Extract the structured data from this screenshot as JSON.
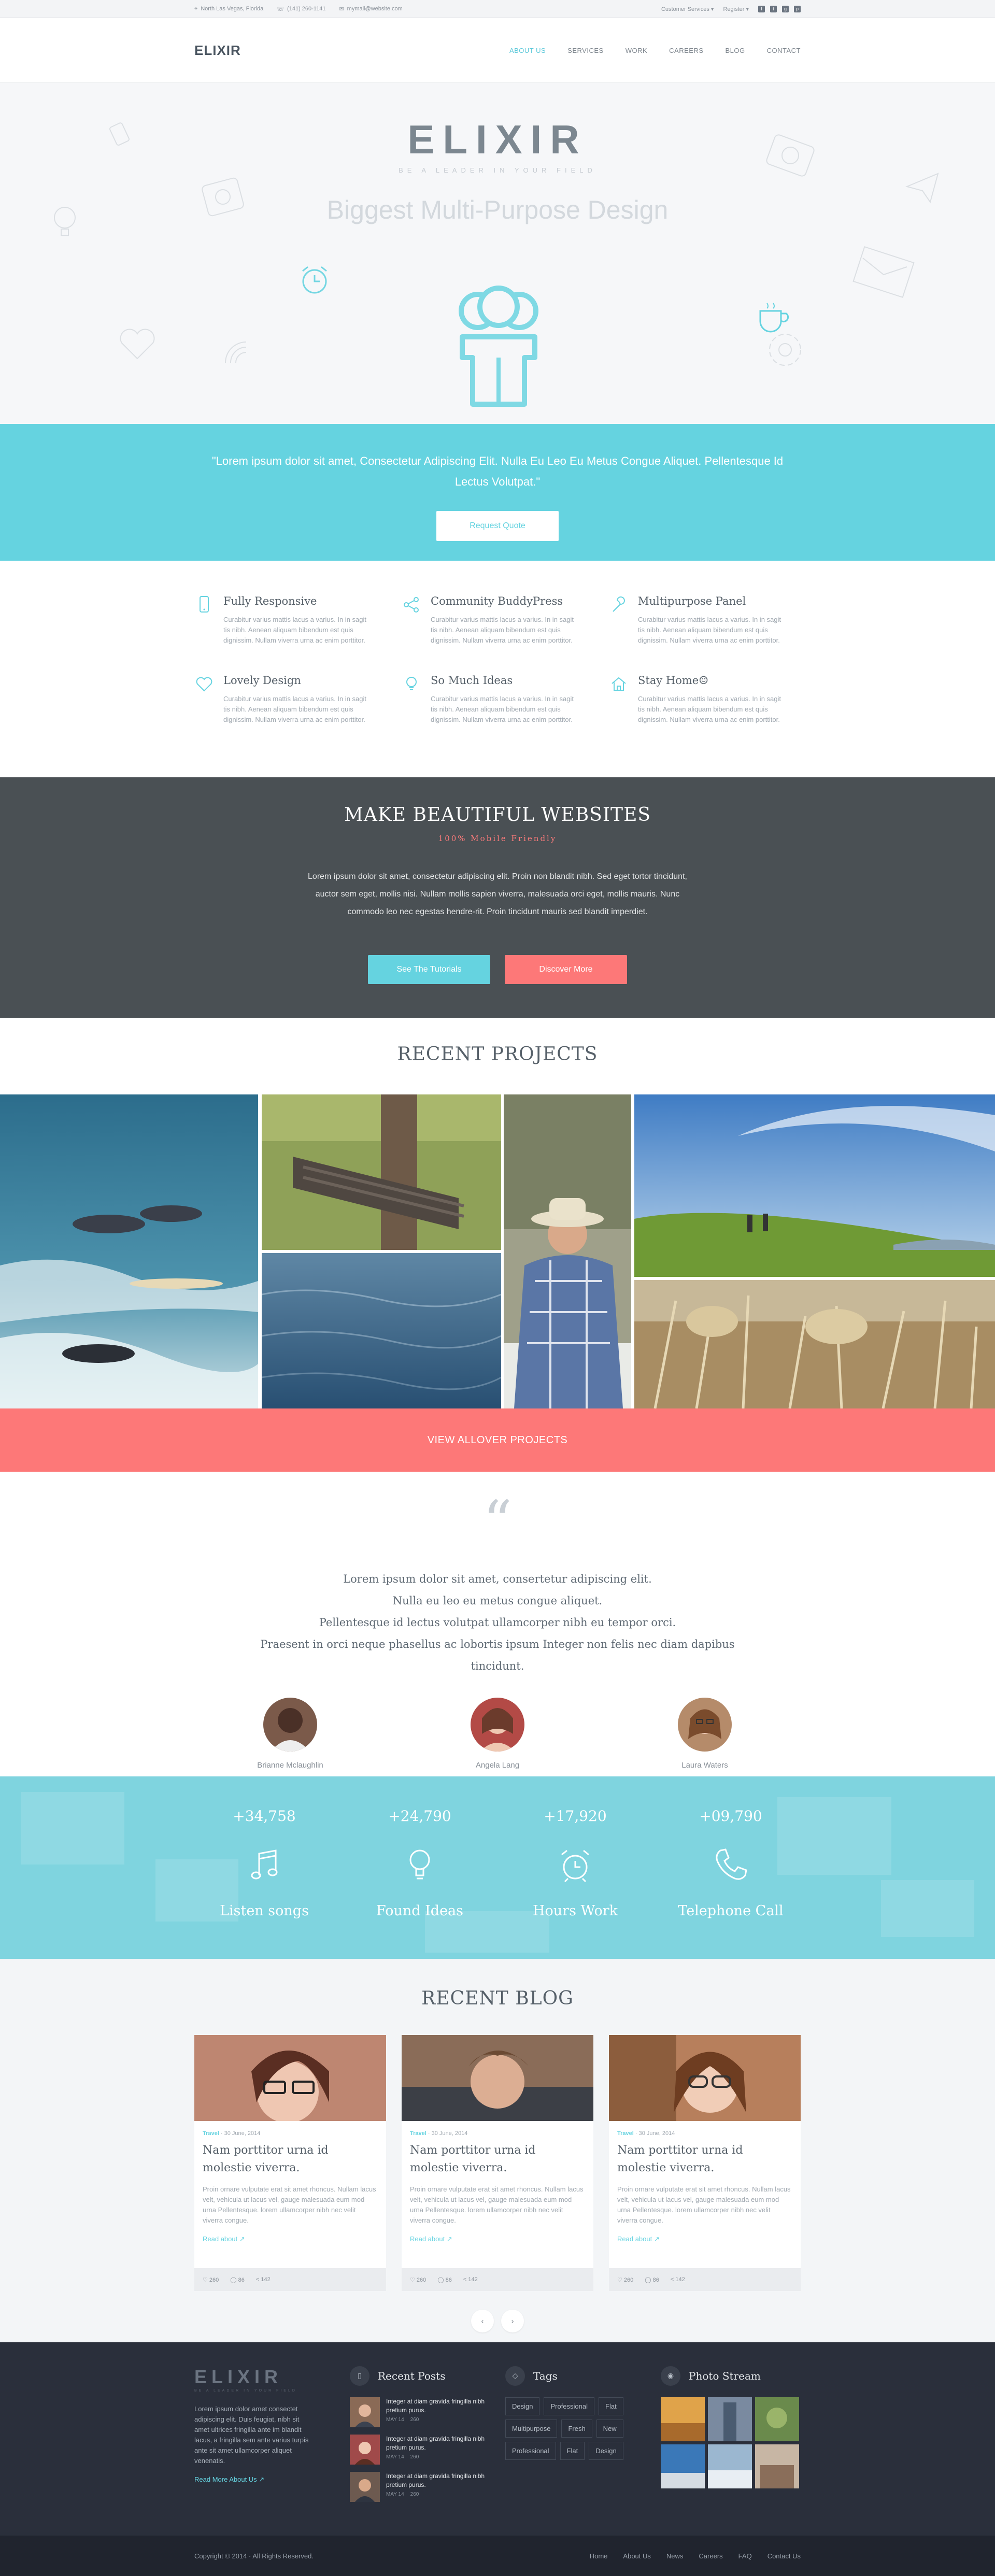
{
  "colors": {
    "accent": "#65d3e0",
    "coral": "#fd7878",
    "dark": "#4a5054",
    "footer": "#2a2f3b"
  },
  "topbar": {
    "address": "North Las Vegas, Florida",
    "phone": "(141) 260-1141",
    "email": "mymail@website.com",
    "customer_services": "Customer Services ▾",
    "register": "Register ▾",
    "social": [
      "f",
      "t",
      "g",
      "p"
    ]
  },
  "header": {
    "logo": "ELIXIR",
    "nav": [
      "ABOUT US",
      "SERVICES",
      "WORK",
      "CAREERS",
      "BLOG",
      "CONTACT"
    ]
  },
  "hero": {
    "brand": "ELIXIR",
    "tagline": "BE A LEADER IN YOUR FIELD",
    "headline": "Biggest Multi-Purpose Design"
  },
  "strip": {
    "quote": "\"Lorem ipsum dolor sit amet, Consectetur Adipiscing Elit. Nulla Eu Leo Eu Metus Congue Aliquet. Pellentesque Id Lectus Volutpat.\"",
    "button": "Request Quote"
  },
  "features": [
    {
      "icon": "phone-icon",
      "title": "Fully Responsive",
      "text": "Curabitur varius mattis lacus a varius. In in sagit tis nibh. Aenean aliquam bibendum est quis dignissim. Nullam viverra urna ac enim porttitor."
    },
    {
      "icon": "share-icon",
      "title": "Community BuddyPress",
      "text": "Curabitur varius mattis lacus a varius. In in sagit tis nibh. Aenean aliquam bibendum est quis dignissim. Nullam viverra urna ac enim porttitor."
    },
    {
      "icon": "wrench-icon",
      "title": "Multipurpose Panel",
      "text": "Curabitur varius mattis lacus a varius. In in sagit tis nibh. Aenean aliquam bibendum est quis dignissim. Nullam viverra urna ac enim porttitor."
    },
    {
      "icon": "heart-icon",
      "title": "Lovely Design",
      "text": "Curabitur varius mattis lacus a varius. In in sagit tis nibh. Aenean aliquam bibendum est quis dignissim. Nullam viverra urna ac enim porttitor."
    },
    {
      "icon": "bulb-icon",
      "title": "So Much Ideas",
      "text": "Curabitur varius mattis lacus a varius. In in sagit tis nibh. Aenean aliquam bibendum est quis dignissim. Nullam viverra urna ac enim porttitor."
    },
    {
      "icon": "home-icon",
      "title": "Stay Home☺",
      "text": "Curabitur varius mattis lacus a varius. In in sagit tis nibh. Aenean aliquam bibendum est quis dignissim. Nullam viverra urna ac enim porttitor."
    }
  ],
  "dark": {
    "title": "MAKE BEAUTIFUL WEBSITES",
    "subtitle": "100% Mobile Friendly",
    "text": "Lorem ipsum dolor sit amet, consectetur adipiscing elit. Proin non blandit nibh. Sed eget tortor tincidunt, auctor sem eget, mollis nisi. Nullam mollis sapien viverra, malesuada orci eget, mollis mauris. Nunc commodo leo nec egestas hendre-rit. Proin tincidunt mauris sed blandit imperdiet.",
    "btn_tutorials": "See The Tutorials",
    "btn_discover": "Discover More"
  },
  "projects": {
    "title": "RECENT PROJECTS",
    "view_all": "VIEW ALLOVER PROJECTS"
  },
  "testimonials": {
    "quote_mark": "“",
    "lines": [
      "Lorem ipsum dolor sit amet, consertetur adipiscing elit.",
      "Nulla eu leo eu metus congue aliquet.",
      "Pellentesque id lectus volutpat ullamcorper nibh eu tempor orci.",
      "Praesent in orci neque phasellus ac lobortis ipsum Integer non felis nec diam dapibus",
      "tincidunt."
    ],
    "people": [
      {
        "name": "Brianne Mclaughlin"
      },
      {
        "name": "Angela Lang"
      },
      {
        "name": "Laura Waters"
      }
    ]
  },
  "stats": [
    {
      "num": "+34,758",
      "label": "Listen songs",
      "icon": "music-note-icon"
    },
    {
      "num": "+24,790",
      "label": "Found Ideas",
      "icon": "bulb-icon"
    },
    {
      "num": "+17,920",
      "label": "Hours Work",
      "icon": "alarm-clock-icon"
    },
    {
      "num": "+09,790",
      "label": "Telephone Call",
      "icon": "telephone-icon"
    }
  ],
  "blog": {
    "title": "RECENT BLOG",
    "posts": [
      {
        "cat": "Travel",
        "date": " · 30 June, 2014",
        "title": "Nam porttitor urna id molestie viverra.",
        "text": "Proin ornare vulputate erat sit amet rhoncus. Nullam lacus velt, vehicula ut lacus vel, gauge malesuada eum mod urna Pellentesque. lorem ullamcorper nibh nec velit viverra congue.",
        "more": "Read about ↗",
        "likes": "260",
        "comments": "86",
        "shares": "142"
      },
      {
        "cat": "Travel",
        "date": " · 30 June, 2014",
        "title": "Nam porttitor urna id molestie viverra.",
        "text": "Proin ornare vulputate erat sit amet rhoncus. Nullam lacus velt, vehicula ut lacus vel, gauge malesuada eum mod urna Pellentesque. lorem ullamcorper nibh nec velit viverra congue.",
        "more": "Read about ↗",
        "likes": "260",
        "comments": "86",
        "shares": "142"
      },
      {
        "cat": "Travel",
        "date": " · 30 June, 2014",
        "title": "Nam porttitor urna id molestie viverra.",
        "text": "Proin ornare vulputate erat sit amet rhoncus. Nullam lacus velt, vehicula ut lacus vel, gauge malesuada eum mod urna Pellentesque. lorem ullamcorper nibh nec velit viverra congue.",
        "more": "Read about ↗",
        "likes": "260",
        "comments": "86",
        "shares": "142"
      }
    ],
    "prev": "‹",
    "next": "›"
  },
  "footer": {
    "logo": "ELIXIR",
    "tag": "BE A LEADER IN YOUR FIELD",
    "about": "Lorem ipsum dolor amet consectet adipiscing elit. Duis feugiat, nibh sit amet ultrices fringilla ante im blandit lacus, a fringilla sem ante varius turpis ante sit amet ullamcorper aliquet venenatis.",
    "more": "Read More About Us ↗",
    "recent_title": "Recent Posts",
    "posts": [
      {
        "title": "Integer at diam gravida fringilla nibh pretium purus.",
        "date": "MAY 14",
        "count": "260"
      },
      {
        "title": "Integer at diam gravida fringilla nibh pretium purus.",
        "date": "MAY 14",
        "count": "260"
      },
      {
        "title": "Integer at diam gravida fringilla nibh pretium purus.",
        "date": "MAY 14",
        "count": "260"
      }
    ],
    "tags_title": "Tags",
    "tags": [
      "Design",
      "Professional",
      "Flat",
      "Multipurpose",
      "Fresh",
      "New",
      "Professional",
      "Flat",
      "Design"
    ],
    "photo_title": "Photo Stream",
    "copyright_pre": "Copyright © 2014 · All Rights Reserved.",
    "links": [
      "Home",
      "About Us",
      "News",
      "Careers",
      "FAQ",
      "Contact Us"
    ]
  }
}
